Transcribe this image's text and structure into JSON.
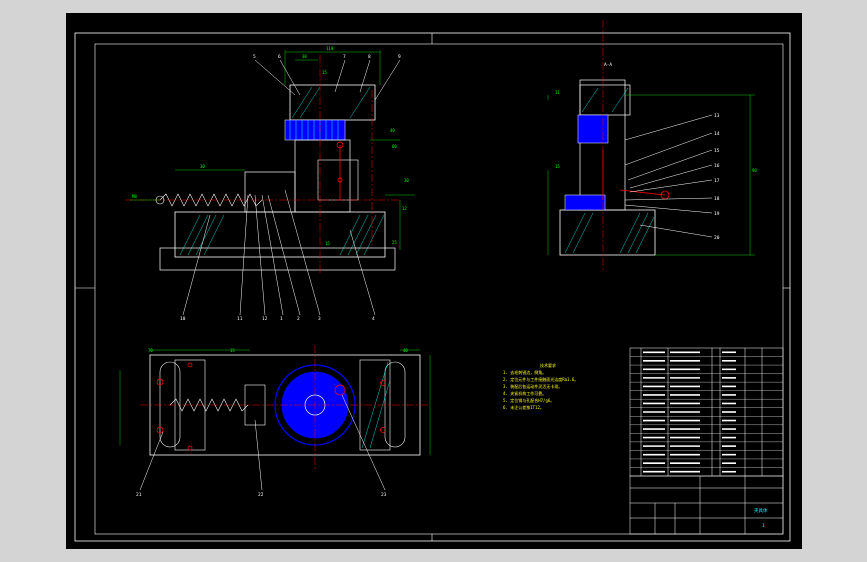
{
  "drawing": {
    "background": "#000000",
    "outer_background": "#d4d4d4",
    "colors": {
      "frame": "#ffffff",
      "part_outline": "#ffffff",
      "hatch": "#00ffff",
      "gear": "#0000ff",
      "centerline": "#ff0000",
      "dimension": "#00ff00",
      "hidden": "#ffff00",
      "leader": "#ffffff"
    }
  },
  "front_view": {
    "dims": {
      "overall_width": "110",
      "top_dim": "30",
      "d_a": "15",
      "d_b": "60",
      "d_c": "12",
      "d_d": "25",
      "d_e": "15",
      "left_dim": "30",
      "thread_label": "M8",
      "right_box": "40",
      "right_dim": "30"
    },
    "balloons": [
      "5",
      "6",
      "7",
      "8",
      "9",
      "10",
      "11",
      "12",
      "1",
      "2",
      "3",
      "4"
    ]
  },
  "side_view": {
    "section_label": "A-A",
    "balloons": [
      "13",
      "14",
      "15",
      "16",
      "17",
      "18",
      "19",
      "20"
    ],
    "dims": {
      "height": "90",
      "left_a": "11",
      "left_b": "15"
    }
  },
  "top_view": {
    "balloons": [
      "21",
      "22",
      "23"
    ],
    "dims": {
      "left": "70",
      "right": "40",
      "left_box": "15"
    }
  },
  "notes": {
    "title": "技术要求",
    "items": [
      "1. 去毛刺锐边，倒角。",
      "2. 定位元件与工件接触面光洁度Ra1.6。",
      "3. 装配后各运动件灵活无卡滞。",
      "4. 夹紧机构工作可靠。",
      "5. 定位销与孔配合H7/g6。",
      "6. 未注公差按IT12。"
    ]
  },
  "bom": {
    "rows": 15,
    "title_block": {
      "name": "夹具体",
      "code": "1"
    }
  }
}
